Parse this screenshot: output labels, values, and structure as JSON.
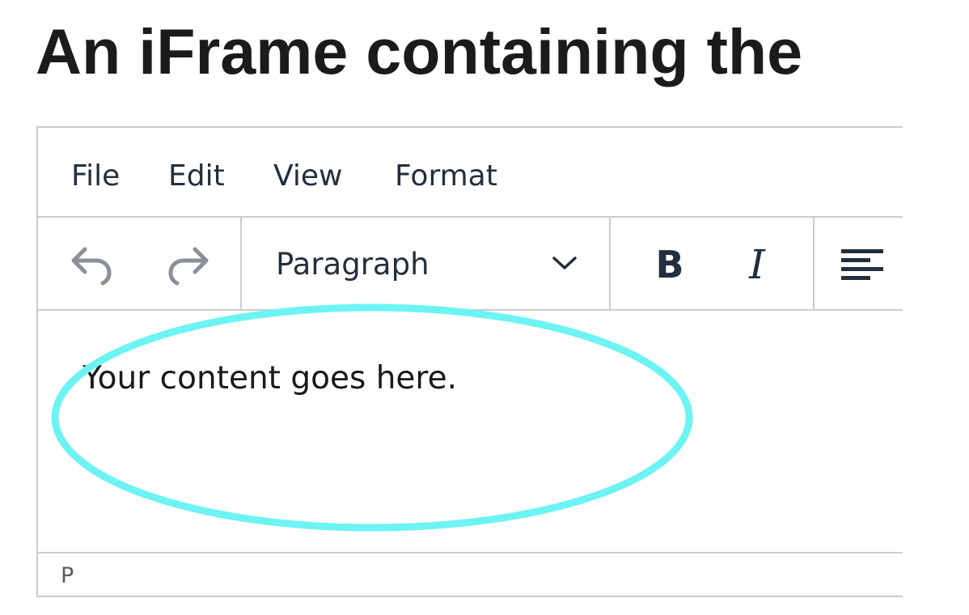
{
  "heading": "An iFrame containing the",
  "menubar": {
    "items": [
      {
        "label": "File"
      },
      {
        "label": "Edit"
      },
      {
        "label": "View"
      },
      {
        "label": "Format"
      }
    ]
  },
  "toolbar": {
    "undo_icon": "undo-icon",
    "redo_icon": "redo-icon",
    "block_format": "Paragraph",
    "bold_label": "B",
    "italic_label": "I",
    "align_icon": "align-left-icon"
  },
  "content": {
    "text": "Your content goes here."
  },
  "statusbar": {
    "path": "P"
  },
  "colors": {
    "highlight": "#6ef3f3",
    "border": "#cccccc",
    "text": "#222f3e"
  }
}
